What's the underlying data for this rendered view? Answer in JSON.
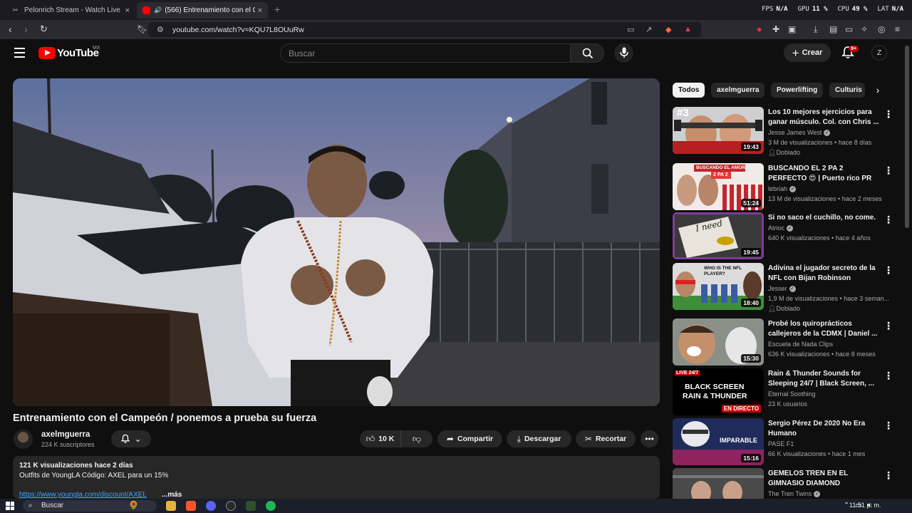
{
  "browser": {
    "tabs": [
      {
        "title": "Pelonrich Stream - Watch Live on",
        "active": false
      },
      {
        "title": "(566) Entrenamiento con el C",
        "active": true
      }
    ],
    "stats": {
      "fps_label": "FPS",
      "fps": "N/A",
      "gpu_label": "GPU",
      "gpu": "11 %",
      "cpu_label": "CPU",
      "cpu": "49 %",
      "lat_label": "LAT",
      "lat": "N/A"
    },
    "url": "youtube.com/watch?v=KQU7L8OUuRw"
  },
  "header": {
    "logo_text": "YouTube",
    "region": "MX",
    "search_placeholder": "Buscar",
    "create_label": "Crear",
    "notif_badge": "9+",
    "avatar_letter": "Z"
  },
  "video": {
    "title": "Entrenamiento con el Campeón / ponemos a prueba su fuerza",
    "channel": "axelmguerra",
    "subscribers": "224 K suscriptores",
    "likes": "10 K",
    "share_label": "Compartir",
    "download_label": "Descargar",
    "clip_label": "Recortar",
    "description": {
      "stats": "121 K visualizaciones  hace 2 días",
      "line": "Outfits de YoungLA Código: AXEL  para un 15%",
      "link": "https://www.youngla.com/discount/AXEL",
      "more": "...más"
    }
  },
  "chips": [
    "Todos",
    "axelmguerra",
    "Powerlifting",
    "Culturis"
  ],
  "recommended": [
    {
      "title": "Los 10 mejores ejercicios para ganar músculo. Col. con Chris ...",
      "channel": "Jesse James West",
      "verified": true,
      "meta": "3 M de visualizaciones • hace 8 días",
      "badge": "Doblado",
      "duration": "19:43"
    },
    {
      "title": "BUSCANDO EL 2 PA 2 PERFECTO 😍 | Puerto rico PR",
      "channel": "lebriah",
      "verified": true,
      "meta": "13 M de visualizaciones • hace 2 meses",
      "badge": "",
      "duration": "51:24"
    },
    {
      "title": "Si no saco el cuchillo, no come.",
      "channel": "Atrioc",
      "verified": true,
      "meta": "640 K visualizaciones • hace 4 años",
      "badge": "",
      "duration": "19:45"
    },
    {
      "title": "Adivina el jugador secreto de la NFL con Bijan Robinson",
      "channel": "Jesser",
      "verified": true,
      "meta": "1,9 M de visualizaciones • hace 3 seman...",
      "badge": "Doblado",
      "duration": "18:40"
    },
    {
      "title": "Probé los quiroprácticos callejeros de la CDMX | Daniel ...",
      "channel": "Escuela de Nada Clips",
      "verified": false,
      "meta": "636 K visualizaciones • hace 8 meses",
      "badge": "",
      "duration": "15:30"
    },
    {
      "title": "Rain & Thunder Sounds for Sleeping 24/7 | Black Screen, ...",
      "channel": "Eternal Soothing",
      "verified": false,
      "meta": "23 K usuarios",
      "badge": "",
      "duration": "EN DIRECTO"
    },
    {
      "title": "Sergio Pérez De 2020 No Era Humano",
      "channel": "PASE F1",
      "verified": false,
      "meta": "66 K visualizaciones • hace 1 mes",
      "badge": "",
      "duration": "15:16"
    },
    {
      "title": "GEMELOS TREN EN EL GIMNASIO DIAMOND",
      "channel": "The Tren Twins",
      "verified": true,
      "meta": "",
      "badge": "",
      "duration": ""
    }
  ],
  "thumb_text": {
    "t1_rank": "#3",
    "t2_banner": "BUSCANDO EL AMOR",
    "t2_sub": "2 PA 2",
    "t3_sign": "I need",
    "t4_q": "WHO IS THE NFL PLAYER?",
    "t6_live": "LIVE 24/7",
    "t6_l1": "BLACK SCREEN",
    "t6_l2": "RAIN & THUNDER",
    "t7_text": "IMPARABLE"
  },
  "taskbar": {
    "search": "Buscar",
    "time": "11:51 p. m."
  }
}
